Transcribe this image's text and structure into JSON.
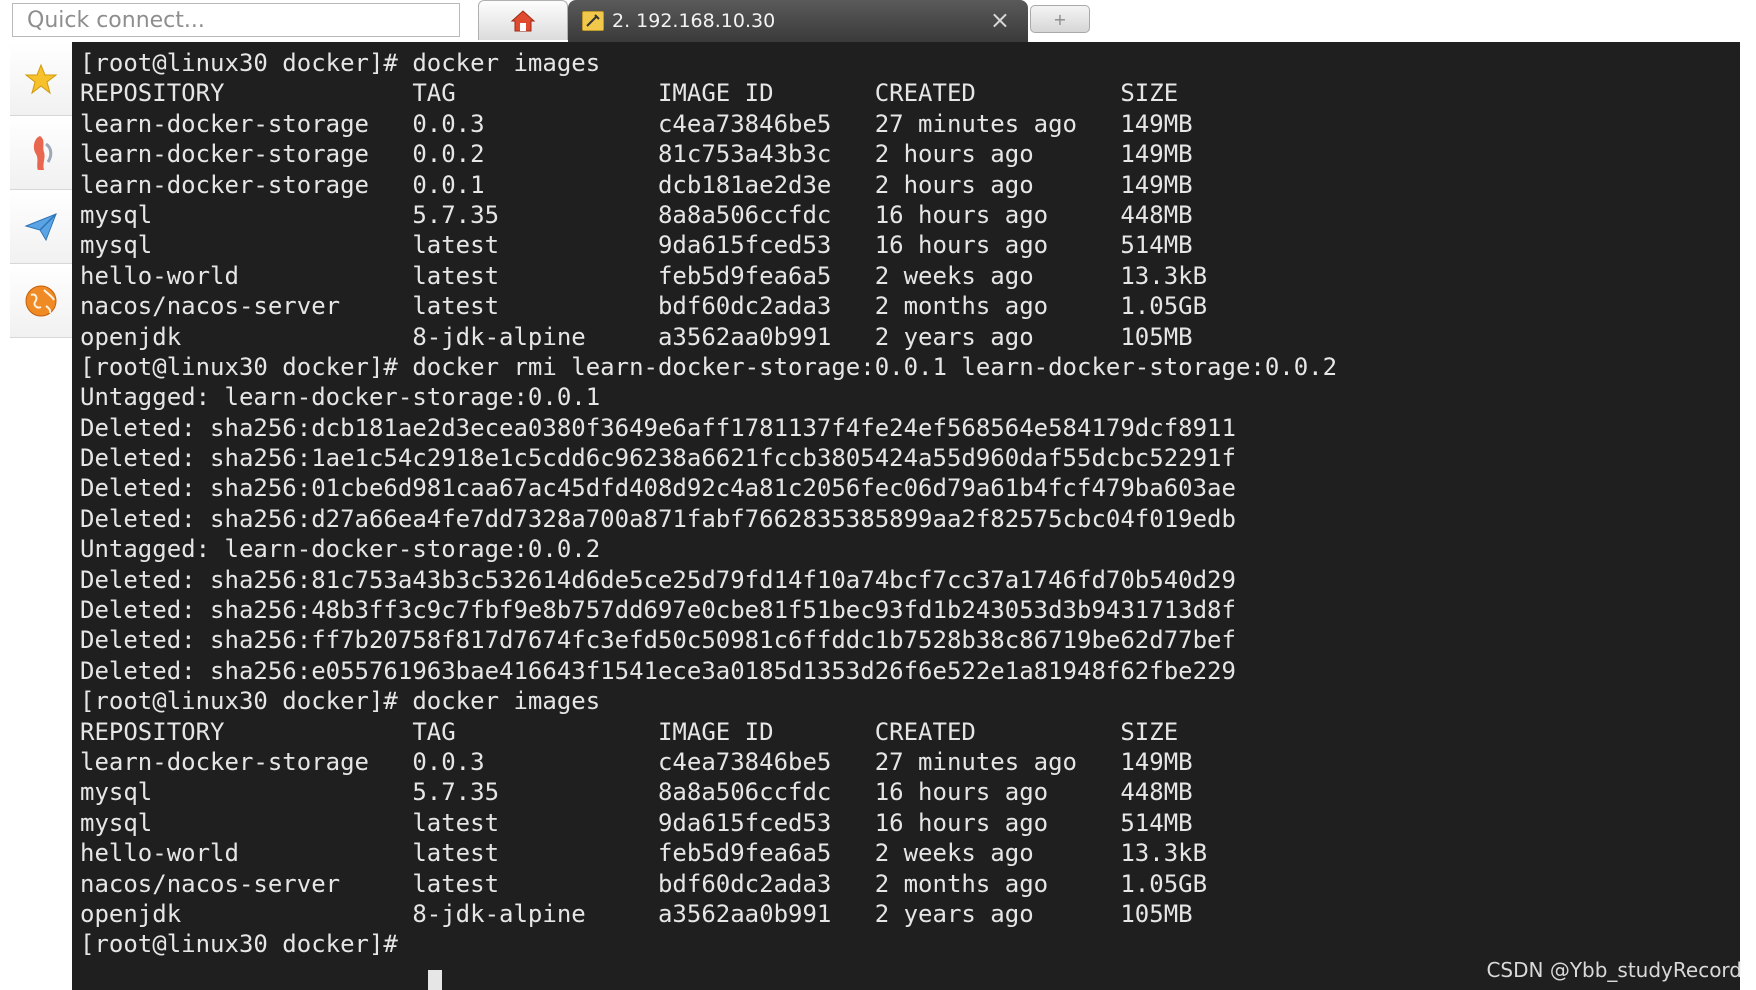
{
  "topbar": {
    "quick_connect_placeholder": "Quick connect...",
    "active_tab_label": "2. 192.168.10.30",
    "close_glyph": "×",
    "new_tab_glyph": "+"
  },
  "sidebar": {
    "items": [
      {
        "icon": "star-icon"
      },
      {
        "icon": "telnet-icon"
      },
      {
        "icon": "paper-plane-icon"
      },
      {
        "icon": "globe-icon"
      }
    ]
  },
  "terminal": {
    "lines": [
      "[root@linux30 docker]# docker images",
      "REPOSITORY             TAG              IMAGE ID       CREATED          SIZE",
      "learn-docker-storage   0.0.3            c4ea73846be5   27 minutes ago   149MB",
      "learn-docker-storage   0.0.2            81c753a43b3c   2 hours ago      149MB",
      "learn-docker-storage   0.0.1            dcb181ae2d3e   2 hours ago      149MB",
      "mysql                  5.7.35           8a8a506ccfdc   16 hours ago     448MB",
      "mysql                  latest           9da615fced53   16 hours ago     514MB",
      "hello-world            latest           feb5d9fea6a5   2 weeks ago      13.3kB",
      "nacos/nacos-server     latest           bdf60dc2ada3   2 months ago     1.05GB",
      "openjdk                8-jdk-alpine     a3562aa0b991   2 years ago      105MB",
      "[root@linux30 docker]# docker rmi learn-docker-storage:0.0.1 learn-docker-storage:0.0.2",
      "Untagged: learn-docker-storage:0.0.1",
      "Deleted: sha256:dcb181ae2d3ecea0380f3649e6aff1781137f4fe24ef568564e584179dcf8911",
      "Deleted: sha256:1ae1c54c2918e1c5cdd6c96238a6621fccb3805424a55d960daf55dcbc52291f",
      "Deleted: sha256:01cbe6d981caa67ac45dfd408d92c4a81c2056fec06d79a61b4fcf479ba603ae",
      "Deleted: sha256:d27a66ea4fe7dd7328a700a871fabf7662835385899aa2f82575cbc04f019edb",
      "Untagged: learn-docker-storage:0.0.2",
      "Deleted: sha256:81c753a43b3c532614d6de5ce25d79fd14f10a74bcf7cc37a1746fd70b540d29",
      "Deleted: sha256:48b3ff3c9c7fbf9e8b757dd697e0cbe81f51bec93fd1b243053d3b9431713d8f",
      "Deleted: sha256:ff7b20758f817d7674fc3efd50c50981c6ffddc1b7528b38c86719be62d77bef",
      "Deleted: sha256:e055761963bae416643f1541ece3a0185d1353d26f6e522e1a81948f62fbe229",
      "[root@linux30 docker]# docker images",
      "REPOSITORY             TAG              IMAGE ID       CREATED          SIZE",
      "learn-docker-storage   0.0.3            c4ea73846be5   27 minutes ago   149MB",
      "mysql                  5.7.35           8a8a506ccfdc   16 hours ago     448MB",
      "mysql                  latest           9da615fced53   16 hours ago     514MB",
      "hello-world            latest           feb5d9fea6a5   2 weeks ago      13.3kB",
      "nacos/nacos-server     latest           bdf60dc2ada3   2 months ago     1.05GB",
      "openjdk                8-jdk-alpine     a3562aa0b991   2 years ago      105MB",
      "[root@linux30 docker]# "
    ]
  },
  "watermark": "CSDN @Ybb_studyRecord",
  "colors": {
    "terminal_bg": "#1f1f1f",
    "terminal_fg": "#e6e6e6",
    "tab_active_bg": "#444444"
  }
}
